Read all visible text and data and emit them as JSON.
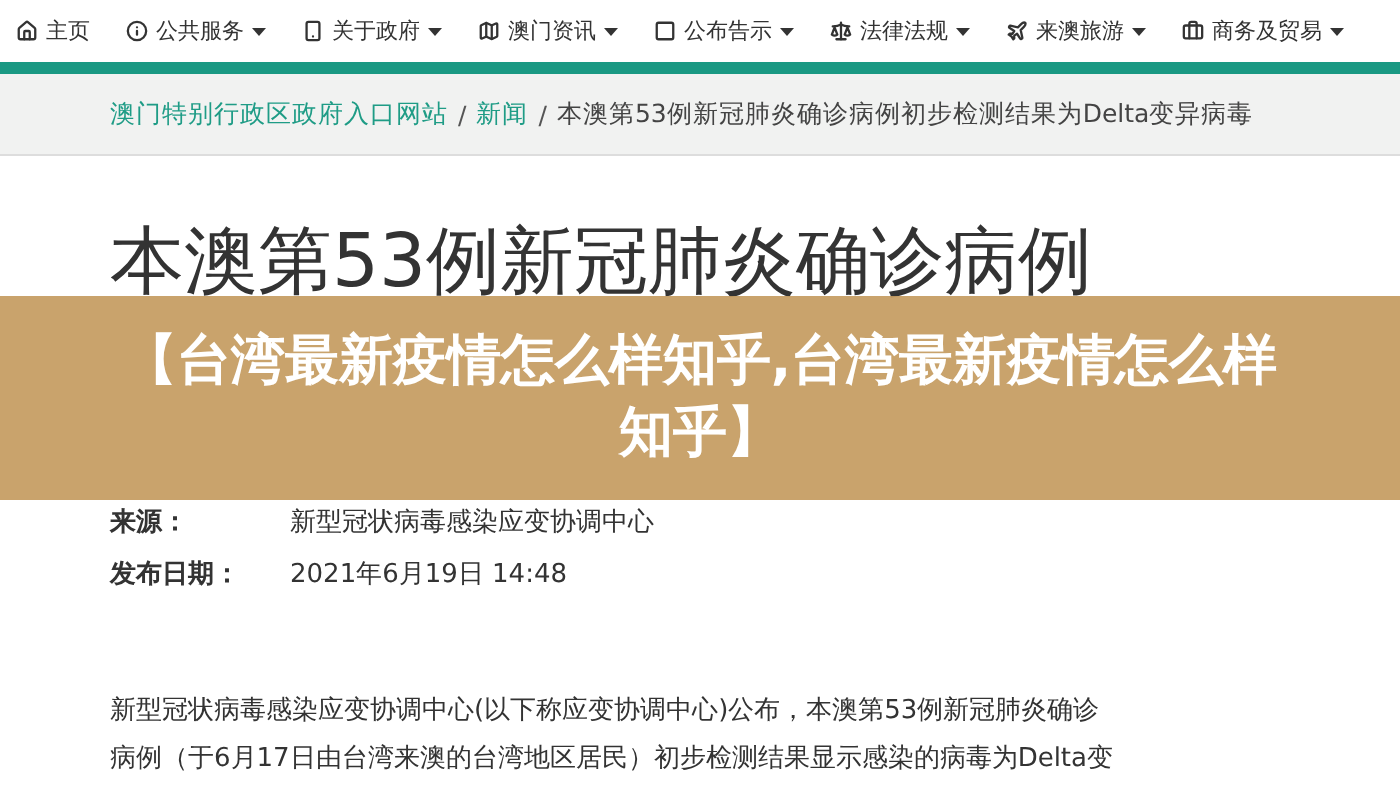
{
  "nav": [
    {
      "label": "主页",
      "dropdown": false
    },
    {
      "label": "公共服务",
      "dropdown": true
    },
    {
      "label": "关于政府",
      "dropdown": true
    },
    {
      "label": "澳门资讯",
      "dropdown": true
    },
    {
      "label": "公布告示",
      "dropdown": true
    },
    {
      "label": "法律法规",
      "dropdown": true
    },
    {
      "label": "来澳旅游",
      "dropdown": true
    },
    {
      "label": "商务及贸易",
      "dropdown": true
    }
  ],
  "breadcrumb": [
    {
      "label": "澳门特别行政区政府入口网站",
      "link": true
    },
    {
      "separator": "/",
      "label": "新闻",
      "link": true
    },
    {
      "separator": "/",
      "label": "本澳第53例新冠肺炎确诊病例初步检测结果为Delta变异病毒",
      "link": false
    }
  ],
  "article": {
    "title": "本澳第53例新冠肺炎确诊病例",
    "meta": [
      {
        "label": "来源：",
        "value": "新型冠状病毒感染应变协调中心"
      },
      {
        "label": "发布日期：",
        "value": "2021年6月19日 14:48"
      }
    ],
    "paragraph_lines": [
      "新型冠状病毒感染应变协调中心(以下称应变协调中心)公布，本澳第53例新冠肺炎确诊",
      "病例（于6月17日由台湾来澳的台湾地区居民）初步检测结果显示感染的病毒为Delta变"
    ]
  },
  "banner": {
    "title": "【台湾最新疫情怎么样知乎,台湾最新疫情怎么样知乎】"
  }
}
